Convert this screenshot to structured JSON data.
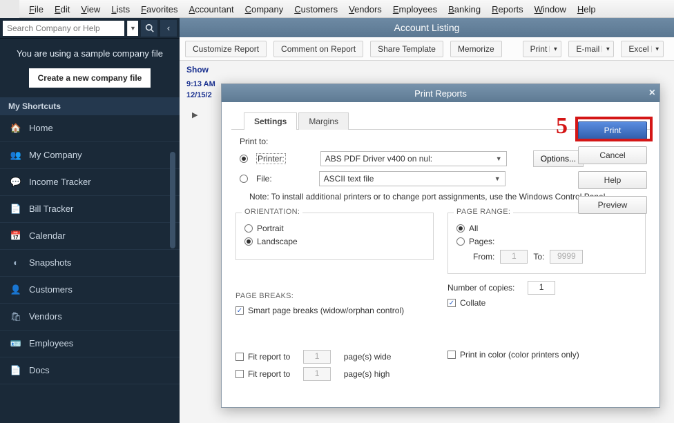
{
  "menu": {
    "items": [
      "File",
      "Edit",
      "View",
      "Lists",
      "Favorites",
      "Accountant",
      "Company",
      "Customers",
      "Vendors",
      "Employees",
      "Banking",
      "Reports",
      "Window",
      "Help"
    ]
  },
  "search": {
    "placeholder": "Search Company or Help"
  },
  "sample": {
    "msg": "You are using a sample company file",
    "btn": "Create a new company file"
  },
  "shortcuts_hdr": "My Shortcuts",
  "nav": {
    "items": [
      {
        "icon": "home",
        "label": "Home"
      },
      {
        "icon": "company",
        "label": "My Company"
      },
      {
        "icon": "income",
        "label": "Income Tracker"
      },
      {
        "icon": "bill",
        "label": "Bill Tracker"
      },
      {
        "icon": "calendar",
        "label": "Calendar"
      },
      {
        "icon": "pie",
        "label": "Snapshots"
      },
      {
        "icon": "person",
        "label": "Customers"
      },
      {
        "icon": "bag",
        "label": "Vendors"
      },
      {
        "icon": "badge",
        "label": "Employees"
      },
      {
        "icon": "doc",
        "label": "Docs"
      }
    ]
  },
  "report": {
    "title": "Account Listing"
  },
  "toolbar": {
    "customize": "Customize Report",
    "comment": "Comment on Report",
    "share": "Share Template",
    "memorize": "Memorize",
    "print": "Print",
    "email": "E-mail",
    "excel": "Excel"
  },
  "sub": {
    "show": "Show",
    "time": "9:13 AM",
    "date": "12/15/2"
  },
  "dialog": {
    "title": "Print Reports",
    "tabs": {
      "settings": "Settings",
      "margins": "Margins"
    },
    "printto_label": "Print to:",
    "printer_label": "Printer:",
    "file_label": "File:",
    "printer_value": "ABS PDF Driver v400 on nul:",
    "file_value": "ASCII text file",
    "options_btn": "Options...",
    "note": "Note: To install additional printers or to change port assignments, use the Windows Control Panel.",
    "orientation": {
      "legend": "ORIENTATION:",
      "portrait": "Portrait",
      "landscape": "Landscape"
    },
    "pagerange": {
      "legend": "PAGE RANGE:",
      "all": "All",
      "pages": "Pages:",
      "from": "From:",
      "to": "To:",
      "from_v": "1",
      "to_v": "9999"
    },
    "pagebreaks": {
      "legend": "PAGE BREAKS:",
      "smart": "Smart page breaks (widow/orphan control)"
    },
    "copies": {
      "label": "Number of copies:",
      "value": "1",
      "collate": "Collate"
    },
    "fit": {
      "fit1": "Fit report to",
      "pages_wide": "page(s) wide",
      "fit2": "Fit report to",
      "pages_high": "page(s) high",
      "v": "1"
    },
    "color": "Print in color (color printers only)",
    "btns": {
      "print": "Print",
      "cancel": "Cancel",
      "help": "Help",
      "preview": "Preview"
    }
  },
  "annotation": {
    "num": "5"
  }
}
